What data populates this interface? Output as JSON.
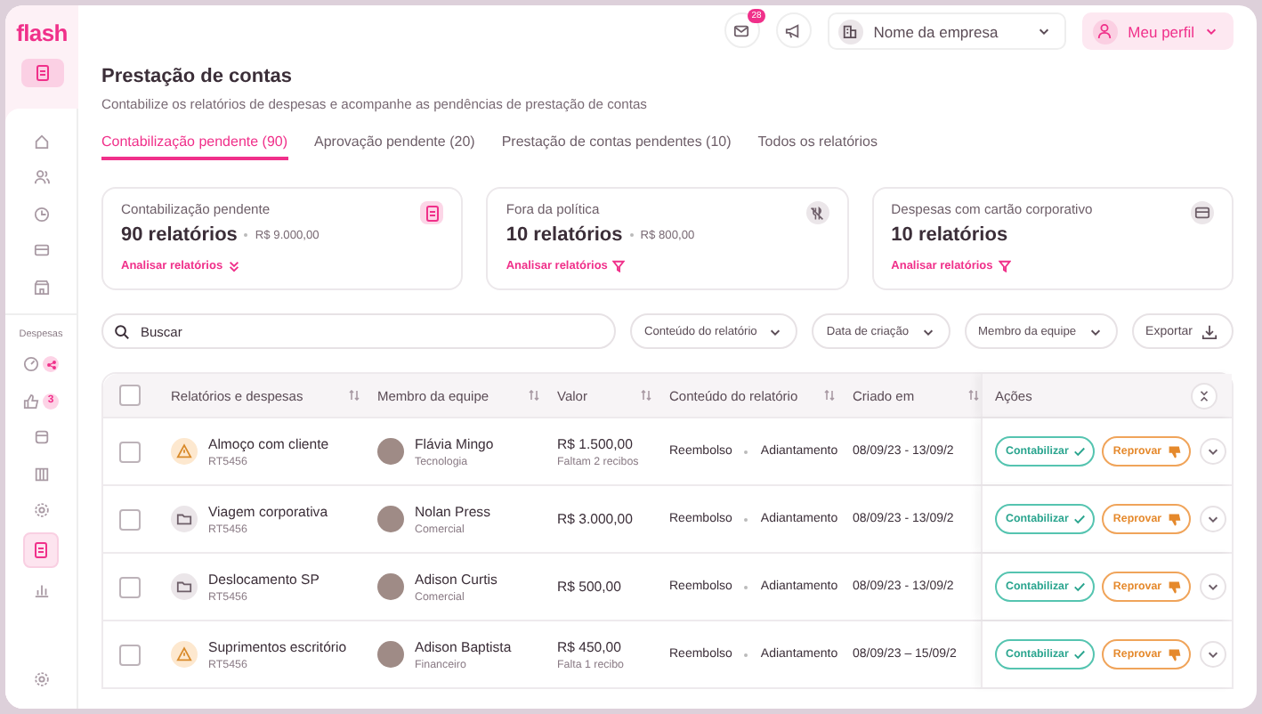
{
  "sidebar": {
    "logo": "flash",
    "top_items": [
      {
        "selected": false
      },
      {
        "selected": false
      },
      {
        "selected": false
      },
      {
        "selected": false
      },
      {
        "selected": false
      }
    ],
    "section_label": "Despesas",
    "section_items": [
      {
        "selected": false,
        "alert": true
      },
      {
        "selected": false,
        "alert": false,
        "badge": "3"
      },
      {
        "selected": false,
        "alert": false
      },
      {
        "selected": false,
        "alert": false
      },
      {
        "selected": false,
        "alert": false
      },
      {
        "selected": true,
        "alert": false
      },
      {
        "selected": false,
        "alert": false
      }
    ]
  },
  "topbar": {
    "notification_count": "28",
    "company": "Nome da empresa",
    "profile": "Meu perfil"
  },
  "page": {
    "title": "Prestação de contas",
    "subtitle": "Contabilize os relatórios de despesas e acompanhe as pendências de prestação de contas",
    "tabs": [
      {
        "label": "Contabilização pendente (90)",
        "selected": true
      },
      {
        "label": "Aprovação pendente (20)",
        "selected": false
      },
      {
        "label": "Prestação de contas pendentes (10)",
        "selected": false
      },
      {
        "label": "Todos os relatórios",
        "selected": false
      }
    ]
  },
  "cards": [
    {
      "kind": "pending",
      "title": "Contabilização pendente",
      "count": "90 relatórios",
      "amount": "R$ 9.000,00",
      "link": "Analisar relatórios"
    },
    {
      "kind": "policy",
      "title": "Fora da política",
      "count": "10 relatórios",
      "amount": "R$ 800,00",
      "link": "Analisar relatórios"
    },
    {
      "kind": "card",
      "title": "Despesas com cartão corporativo",
      "count": "10 relatórios",
      "link": "Analisar relatórios"
    }
  ],
  "toolbar": {
    "search_placeholder": "Buscar",
    "filters": [
      "Conteúdo do relatório",
      "Data de criação",
      "Membro da equipe"
    ],
    "export": "Exportar"
  },
  "table": {
    "select_all_checked": false,
    "columns": [
      {
        "label": "Relatórios e despesas",
        "sortable": true
      },
      {
        "label": "Membro da equipe",
        "sortable": true
      },
      {
        "label": "Valor",
        "sortable": true
      },
      {
        "label": "Conteúdo do relatório",
        "sortable": true
      },
      {
        "label": "Criado em",
        "sortable": true
      },
      {
        "label": "Ações",
        "sortable": false
      }
    ],
    "rows": [
      {
        "checked": false,
        "kind": "alert",
        "title": "Almoço com cliente",
        "code": "RT5456",
        "member": "Flávia Mingo",
        "department": "Tecnologia",
        "value": "R$ 1.500,00",
        "note": "Faltam 2 recibos",
        "content": [
          "Reembolso",
          "Adiantamento"
        ],
        "created": "08/09/23 - 13/09/2",
        "approve": "Contabilizar",
        "reject": "Reprovar"
      },
      {
        "checked": false,
        "kind": "folder",
        "title": "Viagem corporativa",
        "code": "RT5456",
        "member": "Nolan Press",
        "department": "Comercial",
        "value": "R$ 3.000,00",
        "content": [
          "Reembolso",
          "Adiantamento"
        ],
        "created": "08/09/23 - 13/09/2",
        "approve": "Contabilizar",
        "reject": "Reprovar"
      },
      {
        "checked": false,
        "kind": "folder",
        "title": "Deslocamento SP",
        "code": "RT5456",
        "member": "Adison Curtis",
        "department": "Comercial",
        "value": "R$ 500,00",
        "content": [
          "Reembolso",
          "Adiantamento"
        ],
        "created": "08/09/23 - 13/09/2",
        "approve": "Contabilizar",
        "reject": "Reprovar"
      },
      {
        "checked": false,
        "kind": "alert",
        "title": "Suprimentos escritório",
        "code": "RT5456",
        "member": "Adison Baptista",
        "department": "Financeiro",
        "value": "R$ 450,00",
        "note": "Falta 1 recibo",
        "content": [
          "Reembolso",
          "Adiantamento"
        ],
        "created": "08/09/23 – 15/09/2",
        "approve": "Contabilizar",
        "reject": "Reprovar"
      }
    ]
  }
}
